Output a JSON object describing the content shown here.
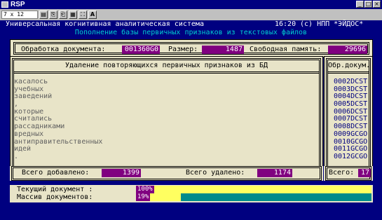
{
  "window": {
    "title": "RSP",
    "buttons": [
      "_",
      "□",
      "×"
    ]
  },
  "toolbar": {
    "font_select": "7 x 12",
    "tools": [
      "▤",
      "⎘",
      "⎗",
      "▦",
      "⛶",
      "A"
    ]
  },
  "header": {
    "system_name": "Универсальная когнитивная аналитическая система",
    "time": "16:20",
    "copyright": "(c) НПП *ЭЙДОС*",
    "subtitle": "Пополнение базы первичных признаков из текстовых файлов"
  },
  "stats": {
    "doc_label": "Обработка документа:",
    "doc_value": "001360G0",
    "size_label": "Размер:",
    "size_value": "1487",
    "memory_label": "Свободная память:",
    "memory_value": "29696"
  },
  "list_panel": {
    "title": "Удаление повторяющихся первичных признаков из БД",
    "words": [
      "касалось",
      "учебных",
      "заведений",
      ",",
      "которые",
      "считались",
      "рассадниками",
      "вредных",
      "антиправительственных",
      "идей",
      "."
    ]
  },
  "code_panel": {
    "title": "Обр.докум.",
    "codes": [
      "0002DCST",
      "0003DCST",
      "0004DCST",
      "0005DCST",
      "0006DCST",
      "0007DCST",
      "0008DCST",
      "0009GCGO",
      "0010GCGO",
      "0011GCGO",
      "0012GCGO"
    ]
  },
  "totals": {
    "added_label": "Всего добавлено:",
    "added_value": "1399",
    "removed_label": "Всего удалено:",
    "removed_value": "1174",
    "total_label": "Всего:",
    "total_value": "17"
  },
  "progress": {
    "current_label": "Текущий документ :",
    "current_pct": "100%",
    "current_fraction": 1.0,
    "array_label": "Массив документов:",
    "array_pct": "19%",
    "array_fraction": 0.19
  },
  "colors": {
    "console_bg": "#000080",
    "panel_bg": "#e8e4c8",
    "value_bg": "#800080",
    "progress_fill": "#ffff60",
    "progress_track": "#008b8b"
  }
}
